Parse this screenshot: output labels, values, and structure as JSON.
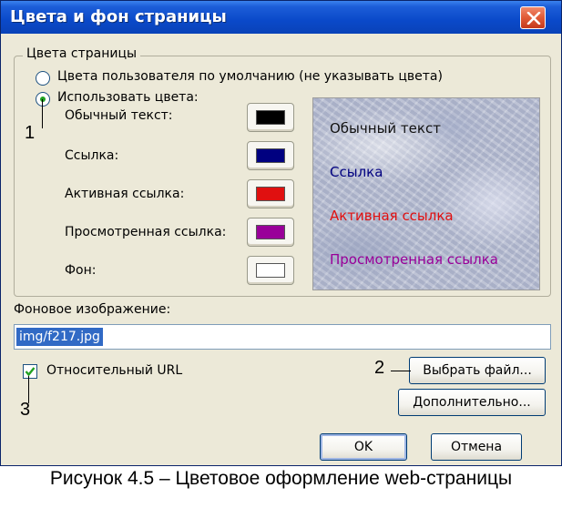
{
  "window": {
    "title": "Цвета и фон страницы",
    "close_icon": "close-icon"
  },
  "page_colors": {
    "group_title": "Цвета страницы",
    "option_default": "Цвета пользователя по умолчанию (не указывать цвета)",
    "option_custom": "Использовать цвета:",
    "selected_option": "custom",
    "items": [
      {
        "label": "Обычный текст:",
        "color": "#000000"
      },
      {
        "label": "Ссылка:",
        "color": "#000080"
      },
      {
        "label": "Активная ссылка:",
        "color": "#e01010"
      },
      {
        "label": "Просмотренная ссылка:",
        "color": "#990099"
      },
      {
        "label": "Фон:",
        "color": "#ffffff"
      }
    ]
  },
  "preview": {
    "normal": "Обычный текст",
    "link": "Ссылка",
    "active": "Активная ссылка",
    "visited": "Просмотренная ссылка"
  },
  "background_image": {
    "label": "Фоновое изображение:",
    "value": "img/f217.jpg",
    "relative_label": "Относительный URL",
    "relative_checked": true
  },
  "buttons": {
    "choose_file": "Выбрать файл...",
    "advanced": "Дополнительно...",
    "ok": "OK",
    "cancel": "Отмена"
  },
  "annotations": {
    "a1": "1",
    "a2": "2",
    "a3": "3"
  },
  "caption": "Рисунок 4.5 – Цветовое оформление web-страницы"
}
